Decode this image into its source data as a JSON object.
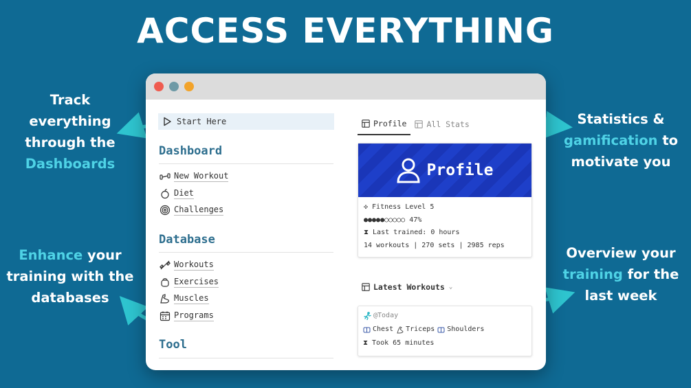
{
  "headline": "ACCESS EVERYTHING",
  "callouts": {
    "top_left": {
      "line1": "Track everything",
      "line2": "through the",
      "line3_hl": "Dashboards"
    },
    "bottom_left": {
      "line1_hl": "Enhance",
      "line1_rest": " your",
      "line2": "training with the",
      "line3": "databases"
    },
    "top_right": {
      "line1": "Statistics &",
      "line2_hl": "gamification",
      "line2_rest": " to",
      "line3": "motivate you"
    },
    "bottom_right": {
      "line1": "Overview your",
      "line2_hl": "training",
      "line2_rest": " for the",
      "line3": "last week"
    }
  },
  "colors": {
    "background": "#0f6a94",
    "highlight": "#4fd3e6",
    "section_title": "#2d6e8e",
    "banner": "#1a36b8"
  },
  "sidebar": {
    "start_here": "Start Here",
    "dashboard_title": "Dashboard",
    "dashboard_items": [
      {
        "label": "New Workout",
        "icon": "dumbbell-icon"
      },
      {
        "label": "Diet",
        "icon": "apple-icon"
      },
      {
        "label": "Challenges",
        "icon": "target-icon"
      }
    ],
    "database_title": "Database",
    "database_items": [
      {
        "label": "Workouts",
        "icon": "barbell-icon"
      },
      {
        "label": "Exercises",
        "icon": "kettlebell-icon"
      },
      {
        "label": "Muscles",
        "icon": "muscle-icon"
      },
      {
        "label": "Programs",
        "icon": "calendar-icon"
      }
    ],
    "tool_title": "Tool"
  },
  "tabs": [
    {
      "label": "Profile",
      "active": true
    },
    {
      "label": "All Stats",
      "active": false
    }
  ],
  "profile_card": {
    "title": "Profile",
    "level": "✣ Fitness Level 5",
    "progress": "●●●●●○○○○○ 47%",
    "progress_value": 0.47,
    "last_trained": "⧗ Last trained: 0 hours",
    "totals": "14 workouts | 270 sets | 2985 reps"
  },
  "latest_workouts": {
    "title": "Latest Workouts",
    "entry": {
      "date": "@Today",
      "muscles": [
        "Chest",
        "Triceps",
        "Shoulders"
      ],
      "duration": "⧗ Took 65 minutes"
    }
  }
}
